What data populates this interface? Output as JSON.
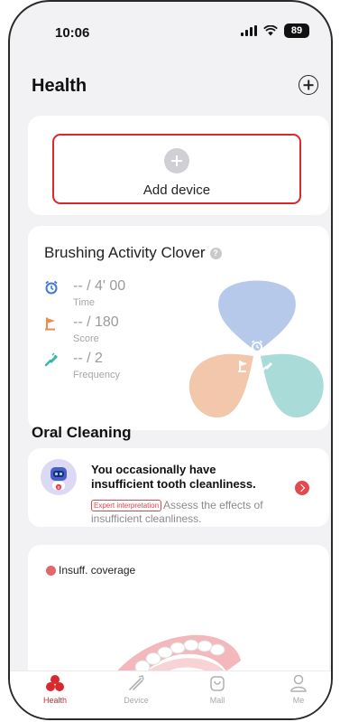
{
  "status_bar": {
    "time": "10:06",
    "battery": "89"
  },
  "header": {
    "title": "Health"
  },
  "add_device": {
    "label": "Add device"
  },
  "clover": {
    "title": "Brushing Activity Clover",
    "help": "?",
    "metrics": [
      {
        "value": "-- / 4' 00",
        "label": "Time",
        "icon": "alarm-clock-icon",
        "color": "#3d7bd6"
      },
      {
        "value": "-- / 180",
        "label": "Score",
        "icon": "flag-icon",
        "color": "#ef8a4c"
      },
      {
        "value": "-- / 2",
        "label": "Frequency",
        "icon": "toothbrush-icon",
        "color": "#35b6ad"
      }
    ],
    "colors": {
      "top": "#b6c9ea",
      "left": "#f3c7ab",
      "right": "#a9dcd8"
    }
  },
  "oral_cleaning": {
    "title": "Oral Cleaning",
    "message_line1": "You occasionally have",
    "message_line2": "insufficient tooth cleanliness.",
    "tag": "Expert interpretation",
    "detail": "Assess the effects of insufficient cleanliness.",
    "avatar_badge": "0"
  },
  "coverage": {
    "legend": "Insuff. coverage",
    "legend_color": "#e2666b"
  },
  "tabbar": {
    "items": [
      {
        "label": "Health",
        "active": true
      },
      {
        "label": "Device",
        "active": false
      },
      {
        "label": "Mall",
        "active": false
      },
      {
        "label": "Me",
        "active": false
      }
    ]
  },
  "colors": {
    "accent": "#d9282f"
  }
}
